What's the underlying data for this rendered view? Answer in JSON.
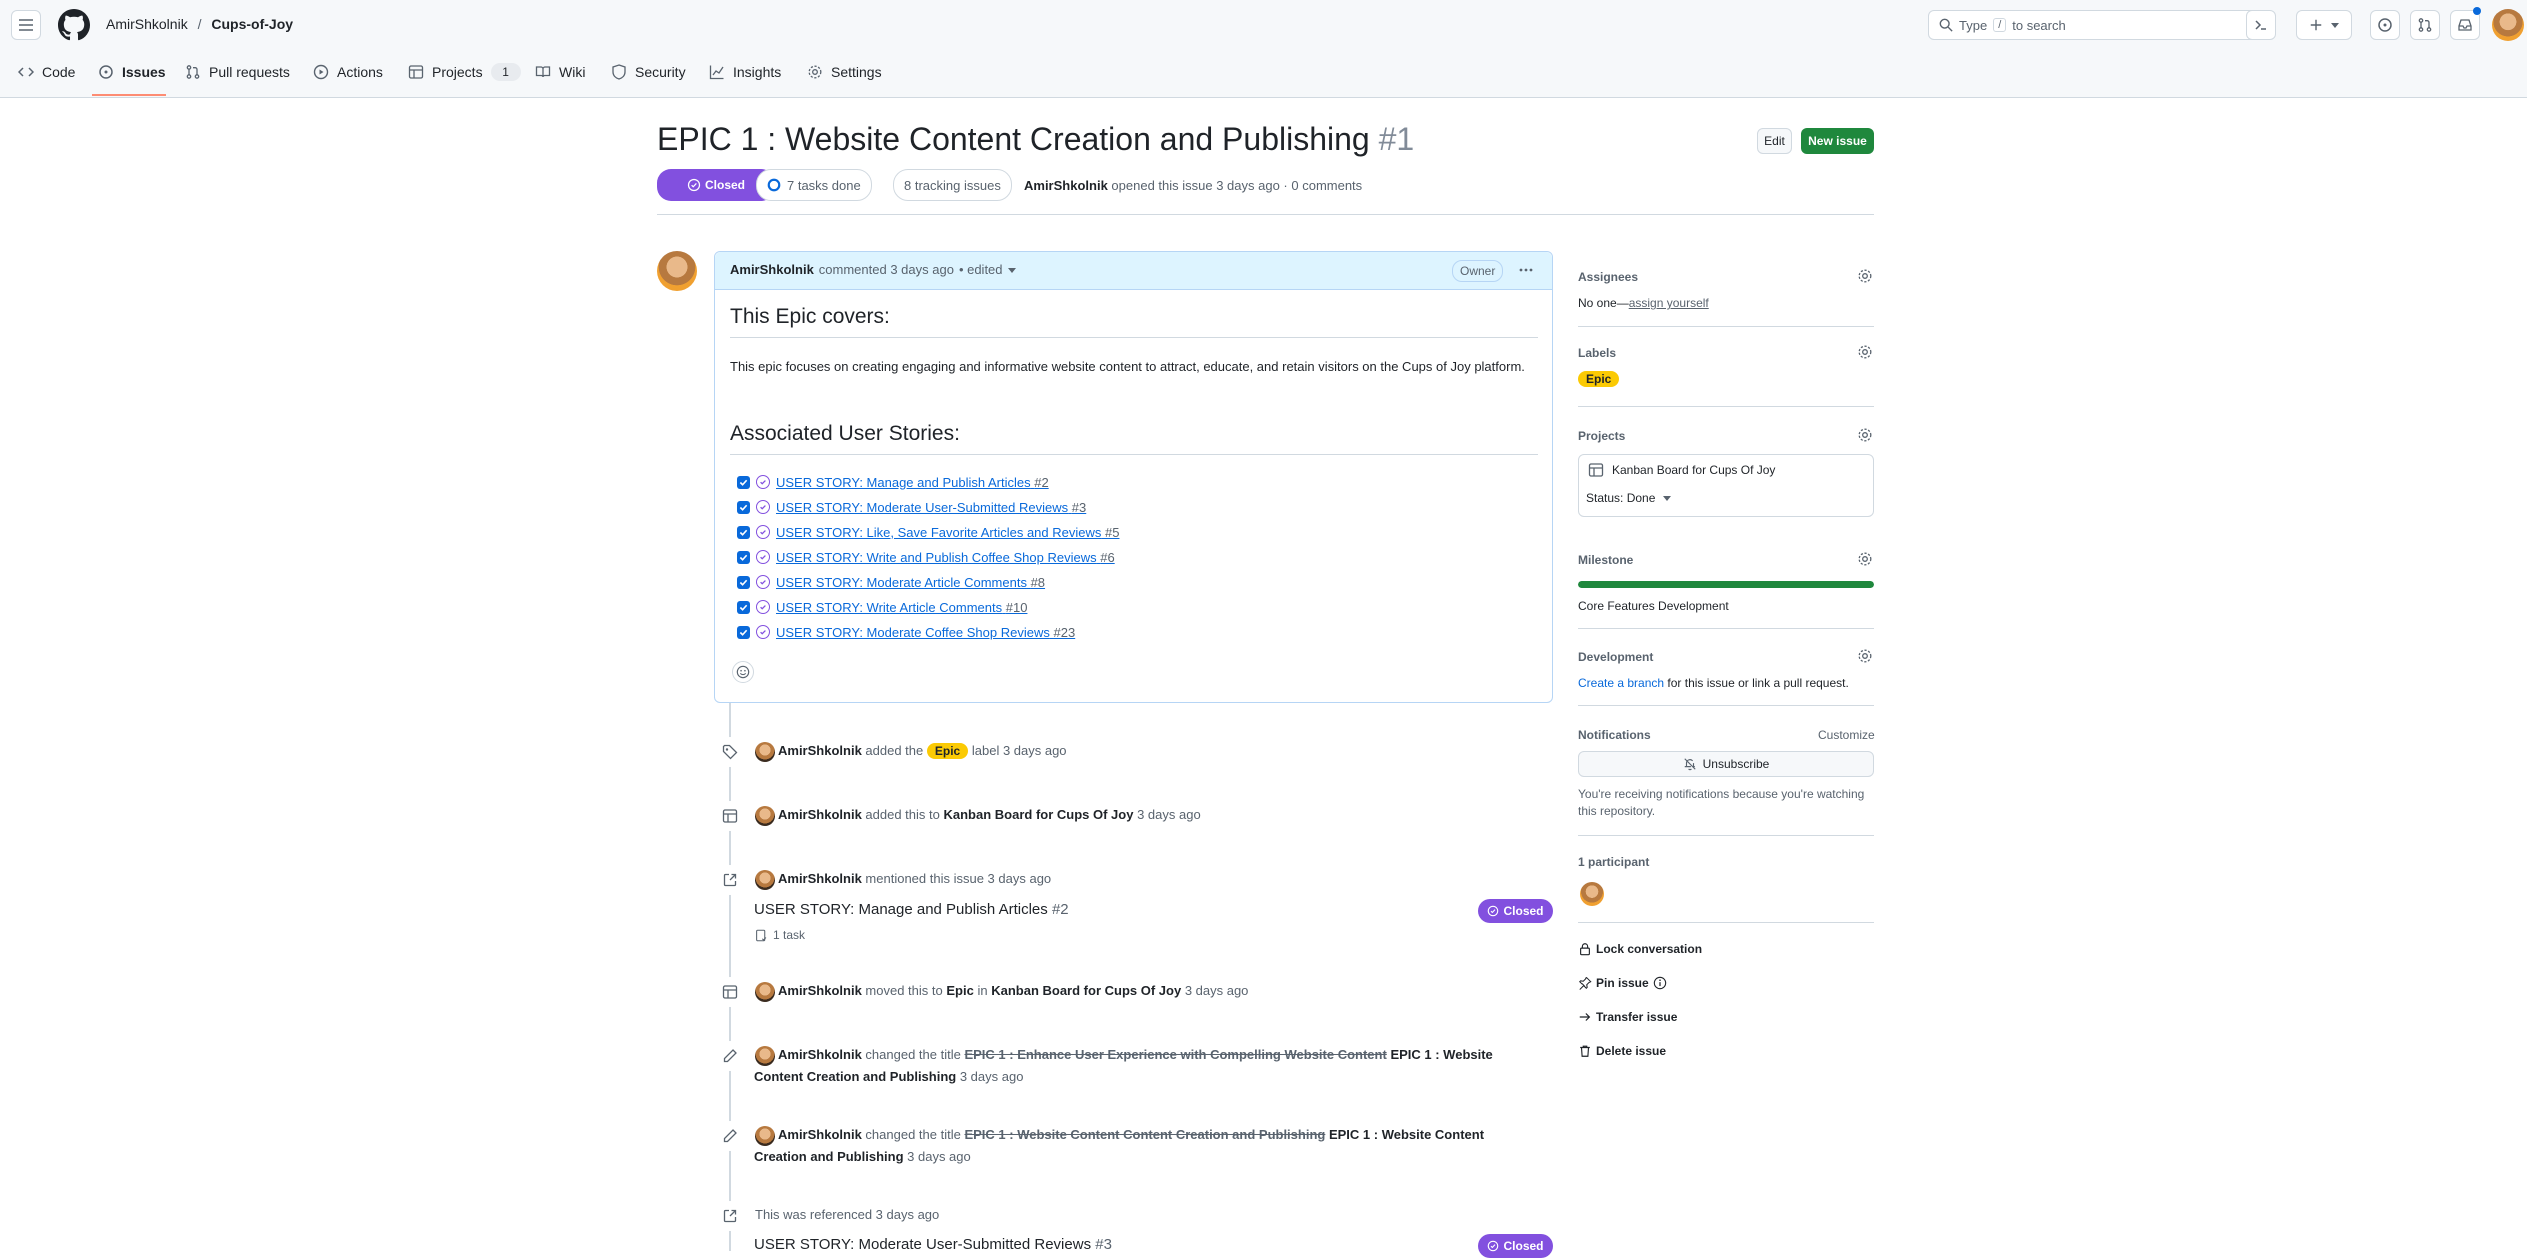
{
  "header": {
    "owner": "AmirShkolnik",
    "separator": "/",
    "repo": "Cups-of-Joy",
    "search_prefix": "Type",
    "search_key": "/",
    "search_suffix": "to search"
  },
  "nav": {
    "tabs": [
      {
        "label": "Code"
      },
      {
        "label": "Issues"
      },
      {
        "label": "Pull requests"
      },
      {
        "label": "Actions"
      },
      {
        "label": "Projects",
        "count": "1"
      },
      {
        "label": "Wiki"
      },
      {
        "label": "Security"
      },
      {
        "label": "Insights"
      },
      {
        "label": "Settings"
      }
    ]
  },
  "issue": {
    "title": "EPIC 1 : Website Content Creation and Publishing",
    "number": "#1",
    "edit_label": "Edit",
    "new_issue_label": "New issue",
    "state": "Closed",
    "tasks_done": "7 tasks done",
    "tracking": "8 tracking issues",
    "author": "AmirShkolnik",
    "meta": "opened this issue 3 days ago · 0 comments"
  },
  "comment": {
    "author": "AmirShkolnik",
    "meta": "commented 3 days ago",
    "edited": "• edited",
    "role": "Owner",
    "heading1": "This Epic covers:",
    "body": "This epic focuses on creating engaging and informative website content to attract, educate, and retain visitors on the Cups of Joy platform.",
    "heading2": "Associated User Stories:",
    "stories": [
      {
        "title": "USER STORY: Manage and Publish Articles",
        "num": "#2"
      },
      {
        "title": "USER STORY: Moderate User-Submitted Reviews",
        "num": "#3"
      },
      {
        "title": "USER STORY: Like, Save Favorite Articles and Reviews",
        "num": "#5"
      },
      {
        "title": "USER STORY: Write and Publish Coffee Shop Reviews",
        "num": "#6"
      },
      {
        "title": "USER STORY: Moderate Article Comments",
        "num": "#8"
      },
      {
        "title": "USER STORY: Write Article Comments",
        "num": "#10"
      },
      {
        "title": "USER STORY: Moderate Coffee Shop Reviews",
        "num": "#23"
      }
    ]
  },
  "timeline": {
    "e1": {
      "actor": "AmirShkolnik",
      "pre": "added the",
      "label": "Epic",
      "post": "label 3 days ago"
    },
    "e2": {
      "actor": "AmirShkolnik",
      "pre": "added this to",
      "project": "Kanban Board for Cups Of Joy",
      "post": "3 days ago"
    },
    "e3": {
      "actor": "AmirShkolnik",
      "text": "mentioned this issue 3 days ago",
      "ref_title": "USER STORY: Manage and Publish Articles",
      "ref_num": "#2",
      "tasks": "1 task",
      "state": "Closed"
    },
    "e4": {
      "actor": "AmirShkolnik",
      "pre": "moved this to",
      "column": "Epic",
      "mid": "in",
      "project": "Kanban Board for Cups Of Joy",
      "post": "3 days ago"
    },
    "e5": {
      "actor": "AmirShkolnik",
      "pre": "changed the title",
      "old": "EPIC 1 : Enhance User Experience with Compelling Website Content",
      "new_a": "EPIC 1 : Website",
      "new_b": "Content Creation and Publishing",
      "post": "3 days ago"
    },
    "e6": {
      "actor": "AmirShkolnik",
      "pre": "changed the title",
      "old": "EPIC 1 : Website Content Content Creation and Publishing",
      "new_a": "EPIC 1 : Website Content",
      "new_b": "Creation and Publishing",
      "post": "3 days ago"
    },
    "e7": {
      "text": "This was referenced 3 days ago",
      "ref_title": "USER STORY: Moderate User-Submitted Reviews",
      "ref_num": "#3",
      "state": "Closed"
    }
  },
  "sidebar": {
    "assignees_label": "Assignees",
    "assignees_none": "No one—",
    "assign_yourself": "assign yourself",
    "labels_label": "Labels",
    "label_epic": "Epic",
    "projects_label": "Projects",
    "project_name": "Kanban Board for Cups Of Joy",
    "project_status": "Status: Done",
    "milestone_label": "Milestone",
    "milestone_progress": 1.0,
    "milestone_name": "Core Features Development",
    "development_label": "Development",
    "dev_link": "Create a branch",
    "dev_text": "for this issue or link a pull request.",
    "notifications_label": "Notifications",
    "customize": "Customize",
    "unsubscribe": "Unsubscribe",
    "notif_reason": "You're receiving notifications because you're watching this repository.",
    "participants": "1 participant",
    "lock": "Lock conversation",
    "pin": "Pin issue",
    "transfer": "Transfer issue",
    "delete": "Delete issue"
  },
  "colors": {
    "accent": "#0969da",
    "closed": "#8250df",
    "success": "#1f883d",
    "epic_label": "#fbca04",
    "tab_underline": "#fd8c73"
  }
}
